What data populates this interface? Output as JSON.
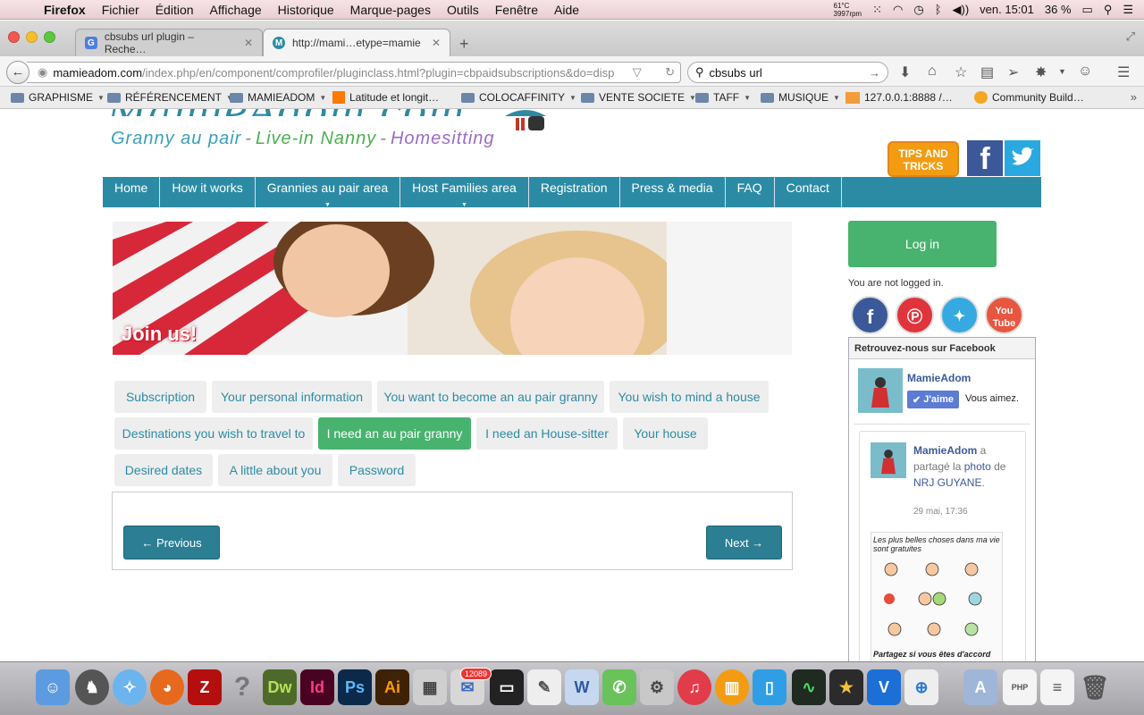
{
  "menubar": {
    "app": "Firefox",
    "items": [
      "Fichier",
      "Édition",
      "Affichage",
      "Historique",
      "Marque-pages",
      "Outils",
      "Fenêtre",
      "Aide"
    ],
    "temp": "61°C",
    "rpm": "3997rpm",
    "clock": "ven. 15:01",
    "battery": "36 %"
  },
  "tabs": [
    {
      "title": "cbsubs url plugin – Reche…",
      "favicon": "G"
    },
    {
      "title": "http://mami…etype=mamie",
      "favicon": "M"
    }
  ],
  "urlbar": {
    "host": "mamieadom.com",
    "path": "/index.php/en/component/comprofiler/pluginclass.html?plugin=cbpaidsubscriptions&do=disp"
  },
  "search": {
    "value": "cbsubs url"
  },
  "bookmarks": [
    {
      "label": "GRAPHISME",
      "type": "folder"
    },
    {
      "label": "RÉFÉRENCEMENT",
      "type": "folder"
    },
    {
      "label": "MAMIEADOM",
      "type": "folder"
    },
    {
      "label": "Latitude et longit…",
      "type": "link"
    },
    {
      "label": "COLOCAFFINITY",
      "type": "folder"
    },
    {
      "label": "VENTE SOCIETE",
      "type": "folder"
    },
    {
      "label": "TAFF",
      "type": "folder"
    },
    {
      "label": "MUSIQUE",
      "type": "folder"
    },
    {
      "label": "127.0.0.1:8888 /…",
      "type": "link"
    },
    {
      "label": "Community Build…",
      "type": "link"
    }
  ],
  "site": {
    "logo": "MamieAdom.com",
    "tagline": [
      "Granny au pair",
      "-",
      "Live-in Nanny",
      "-",
      "Homesitting"
    ],
    "tips": "TIPS AND TRICKS",
    "nav": [
      {
        "label": "Home",
        "dropdown": false
      },
      {
        "label": "How it works",
        "dropdown": false
      },
      {
        "label": "Grannies au pair area",
        "dropdown": true
      },
      {
        "label": "Host Families area",
        "dropdown": true
      },
      {
        "label": "Registration",
        "dropdown": false
      },
      {
        "label": "Press & media",
        "dropdown": false
      },
      {
        "label": "FAQ",
        "dropdown": false
      },
      {
        "label": "Contact",
        "dropdown": false
      }
    ],
    "banner_title": "Join us!",
    "steps": [
      "Subscription",
      "Your personal information",
      "You want to become an au pair granny",
      "You wish to mind a house",
      "Destinations you wish to travel to",
      "I need an au pair granny",
      "I need an House-sitter",
      "Your house",
      "Desired dates",
      "A little about you",
      "Password"
    ],
    "active_step": "I need an au pair granny",
    "previous": "← Previous",
    "next": "Next →"
  },
  "sidebar": {
    "login": "Log in",
    "status": "You are not logged in.",
    "social": [
      "facebook-icon",
      "pinterest-icon",
      "twitter-icon",
      "youtube-icon"
    ],
    "fb_box_title": "Retrouvez-nous sur Facebook",
    "fb_page": "MamieAdom",
    "fb_like": "J'aime",
    "fb_you_like": "Vous aimez.",
    "post": {
      "author": "MamieAdom",
      "text_a": " a partagé la ",
      "photo": "photo",
      "text_b": " de ",
      "source": "NRJ GUYANE",
      "end": ".",
      "time": "29 mai, 17:36",
      "image_caption_top": "Les plus belles choses dans ma vie sont gratuites",
      "image_caption_bottom": "Partagez si vous êtes d'accord"
    }
  },
  "colors": {
    "accent": "#2c8ba4",
    "green": "#48b26f",
    "orange": "#f39c12",
    "facebook": "#3b5998"
  }
}
